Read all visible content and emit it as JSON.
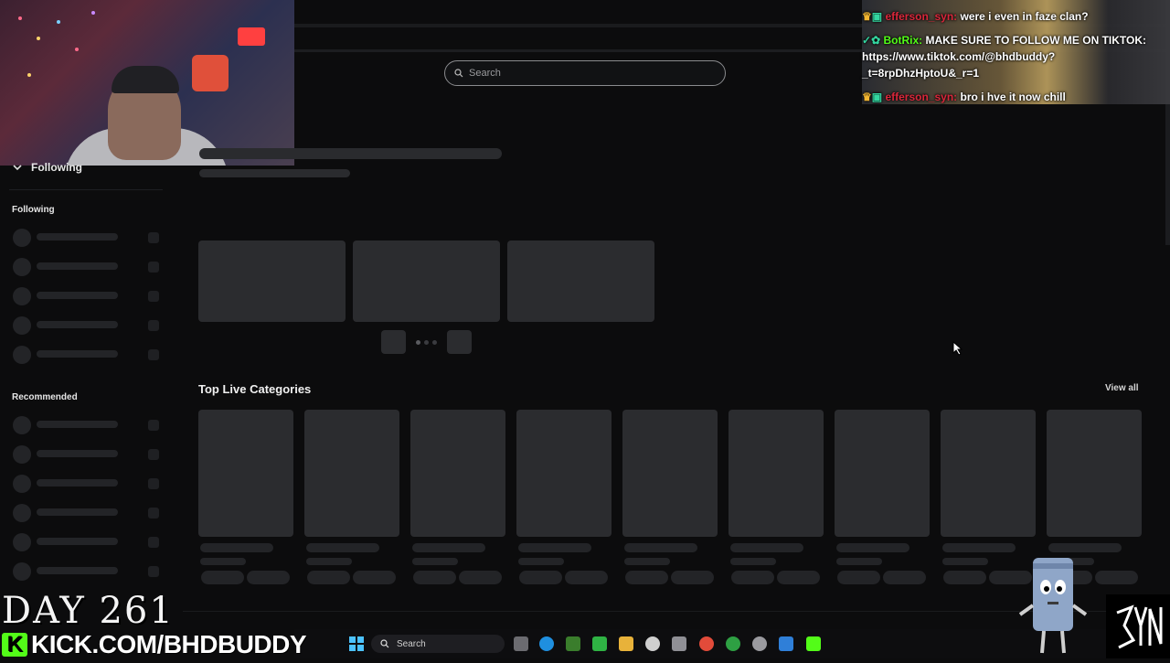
{
  "search": {
    "placeholder": "Search"
  },
  "sidebar": {
    "collapse_label": "Following",
    "following_title": "Following",
    "recommended_title": "Recommended"
  },
  "main": {
    "top_categories_title": "Top Live Categories",
    "view_all_label": "View all"
  },
  "chat": {
    "messages": [
      {
        "user": "efferson_syn:",
        "text": "were i even in faze clan?",
        "user_color": "#d9273b"
      },
      {
        "user": "BotRix:",
        "text": "MAKE SURE TO FOLLOW ME ON TIKTOK: https://www.tiktok.com/@bhdbuddy?_t=8rpDhzHptoU&_r=1",
        "user_color": "#53fc18"
      },
      {
        "user": "efferson_syn:",
        "text": "bro i hve it now chill",
        "user_color": "#d9273b"
      }
    ]
  },
  "overlay": {
    "day_label": "DAY 261",
    "kick_url": "KICK.COM/BHDBUDDY",
    "kick_logo": "K",
    "syn_logo": "SYN"
  },
  "taskbar": {
    "search_label": "Search"
  },
  "colors": {
    "kick_green": "#53fc18",
    "skeleton": "#2b2c2f",
    "background": "#0c0c0d"
  }
}
